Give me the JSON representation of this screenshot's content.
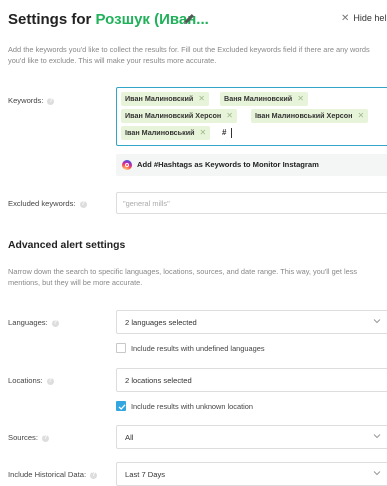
{
  "header": {
    "title_prefix": "Settings for",
    "alert_name": "Розшук (Иван...",
    "hide_help": "Hide help"
  },
  "intro_text": "Add the keywords you'd like to collect the results for. Fill out the Excluded keywords field if there are any words you'd like to exclude. This will make your results more accurate.",
  "keywords": {
    "label": "Keywords:",
    "tags": [
      "Иван Малиновский",
      "Ваня Малиновский",
      "Иван Малиновский Херсон",
      "Іван Малиновський Херсон",
      "Іван Малиновський"
    ],
    "typed_value": "#"
  },
  "instagram_button": "Add #Hashtags as Keywords to Monitor Instagram",
  "excluded": {
    "label": "Excluded keywords:",
    "placeholder": "\"general mills\""
  },
  "advanced": {
    "title": "Advanced alert settings",
    "description": "Narrow down the search to specific languages, locations, sources, and date range. This way, you'll get less mentions, but they will be more accurate."
  },
  "languages": {
    "label": "Languages:",
    "value": "2 languages selected",
    "checkbox_label": "Include results with undefined languages",
    "checked": false
  },
  "locations": {
    "label": "Locations:",
    "value": "2 locations selected",
    "checkbox_label": "Include results with unknown location",
    "checked": true
  },
  "sources": {
    "label": "Sources:",
    "value": "All"
  },
  "historical": {
    "label": "Include Historical Data:",
    "value": "Last 7 Days"
  },
  "colors": {
    "accent_green": "#20b15a",
    "focus_blue": "#32a6c8",
    "checkbox_blue": "#33a6e0",
    "tag_bg": "#e8f4d9"
  },
  "icons": [
    "pencil-icon",
    "close-icon",
    "help-icon",
    "instagram-icon",
    "chevron-down-icon",
    "checkmark-icon"
  ]
}
